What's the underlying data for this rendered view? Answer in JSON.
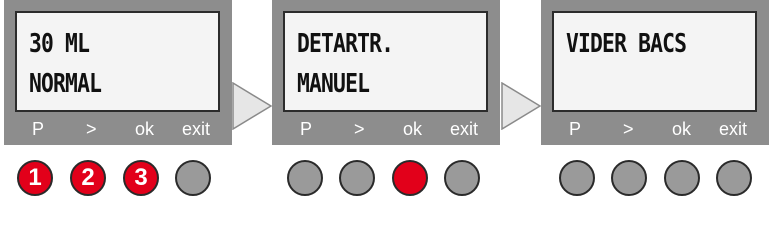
{
  "panels": [
    {
      "lcd_line1": "30 ML",
      "lcd_line2": "NORMAL",
      "keys": [
        "P",
        ">",
        "ok",
        "exit"
      ],
      "indicators": [
        {
          "number": "1",
          "state": "red"
        },
        {
          "number": "2",
          "state": "red"
        },
        {
          "number": "3",
          "state": "red"
        },
        {
          "number": "",
          "state": "grey"
        }
      ]
    },
    {
      "lcd_line1": "DETARTR.",
      "lcd_line2": "MANUEL",
      "keys": [
        "P",
        ">",
        "ok",
        "exit"
      ],
      "indicators": [
        {
          "number": "",
          "state": "grey"
        },
        {
          "number": "",
          "state": "grey"
        },
        {
          "number": "",
          "state": "red"
        },
        {
          "number": "",
          "state": "grey"
        }
      ]
    },
    {
      "lcd_line1": "VIDER BACS",
      "lcd_line2": "",
      "keys": [
        "P",
        ">",
        "ok",
        "exit"
      ],
      "indicators": [
        {
          "number": "",
          "state": "grey"
        },
        {
          "number": "",
          "state": "grey"
        },
        {
          "number": "",
          "state": "grey"
        },
        {
          "number": "",
          "state": "grey"
        }
      ]
    }
  ],
  "arrow_icon": "arrow-right-icon",
  "colors": {
    "panel": "#8d8d8d",
    "screen": "#f4f4f4",
    "indicator_red": "#e2001a",
    "indicator_grey": "#9a9a9a"
  }
}
